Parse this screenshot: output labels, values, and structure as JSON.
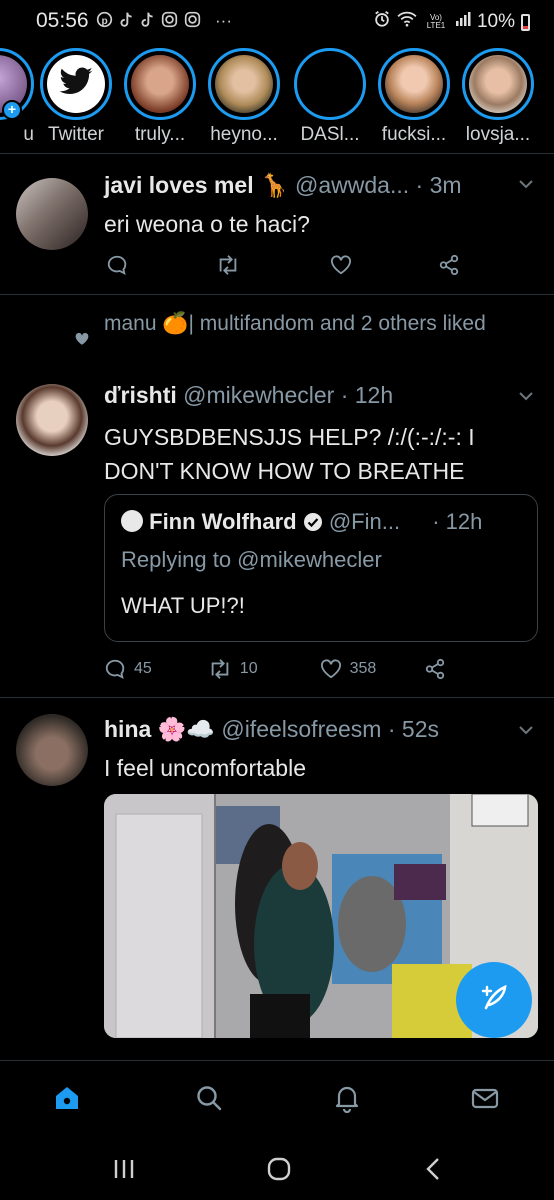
{
  "status_bar": {
    "time": "05:56",
    "icons": [
      "pinterest-icon",
      "tiktok-icon",
      "tiktok-icon",
      "instagram-icon",
      "instagram-icon",
      "more-dots"
    ],
    "more": "···",
    "network": "Vo) LTE1",
    "battery": "10%"
  },
  "fleets": [
    {
      "name": "u"
    },
    {
      "name": "Twitter"
    },
    {
      "name": "truly..."
    },
    {
      "name": "heyno..."
    },
    {
      "name": "DASl..."
    },
    {
      "name": "fucksi..."
    },
    {
      "name": "lovsja..."
    }
  ],
  "tweets": [
    {
      "name": "javi loves mel",
      "emoji": "🦒",
      "handle": "@awwda...",
      "time": "· 3m",
      "text": "eri weona o te haci?"
    },
    {
      "liked_by": "manu 🍊| multifandom and 2 others liked",
      "name": "ďrishti",
      "handle": "@mikewhecler",
      "time": "· 12h",
      "text": "GUYSBDBENSJJS HELP? /:/(:-:/:-: I DON'T KNOW HOW TO BREATHE",
      "quote": {
        "name": "Finn Wolfhard",
        "handle": "@Fin...",
        "time": "· 12h",
        "replying": "Replying to @mikewhecler",
        "text": "WHAT UP!?!"
      },
      "replies": "45",
      "retweets": "10",
      "likes": "358"
    },
    {
      "name": "hina",
      "emoji": "🌸☁️",
      "handle": "@ifeelsofreesm",
      "time": "· 52s",
      "text": "I feel uncomfortable"
    }
  ],
  "colors": {
    "accent": "#1d9bf0",
    "muted": "#8899a6",
    "background": "#000000"
  }
}
